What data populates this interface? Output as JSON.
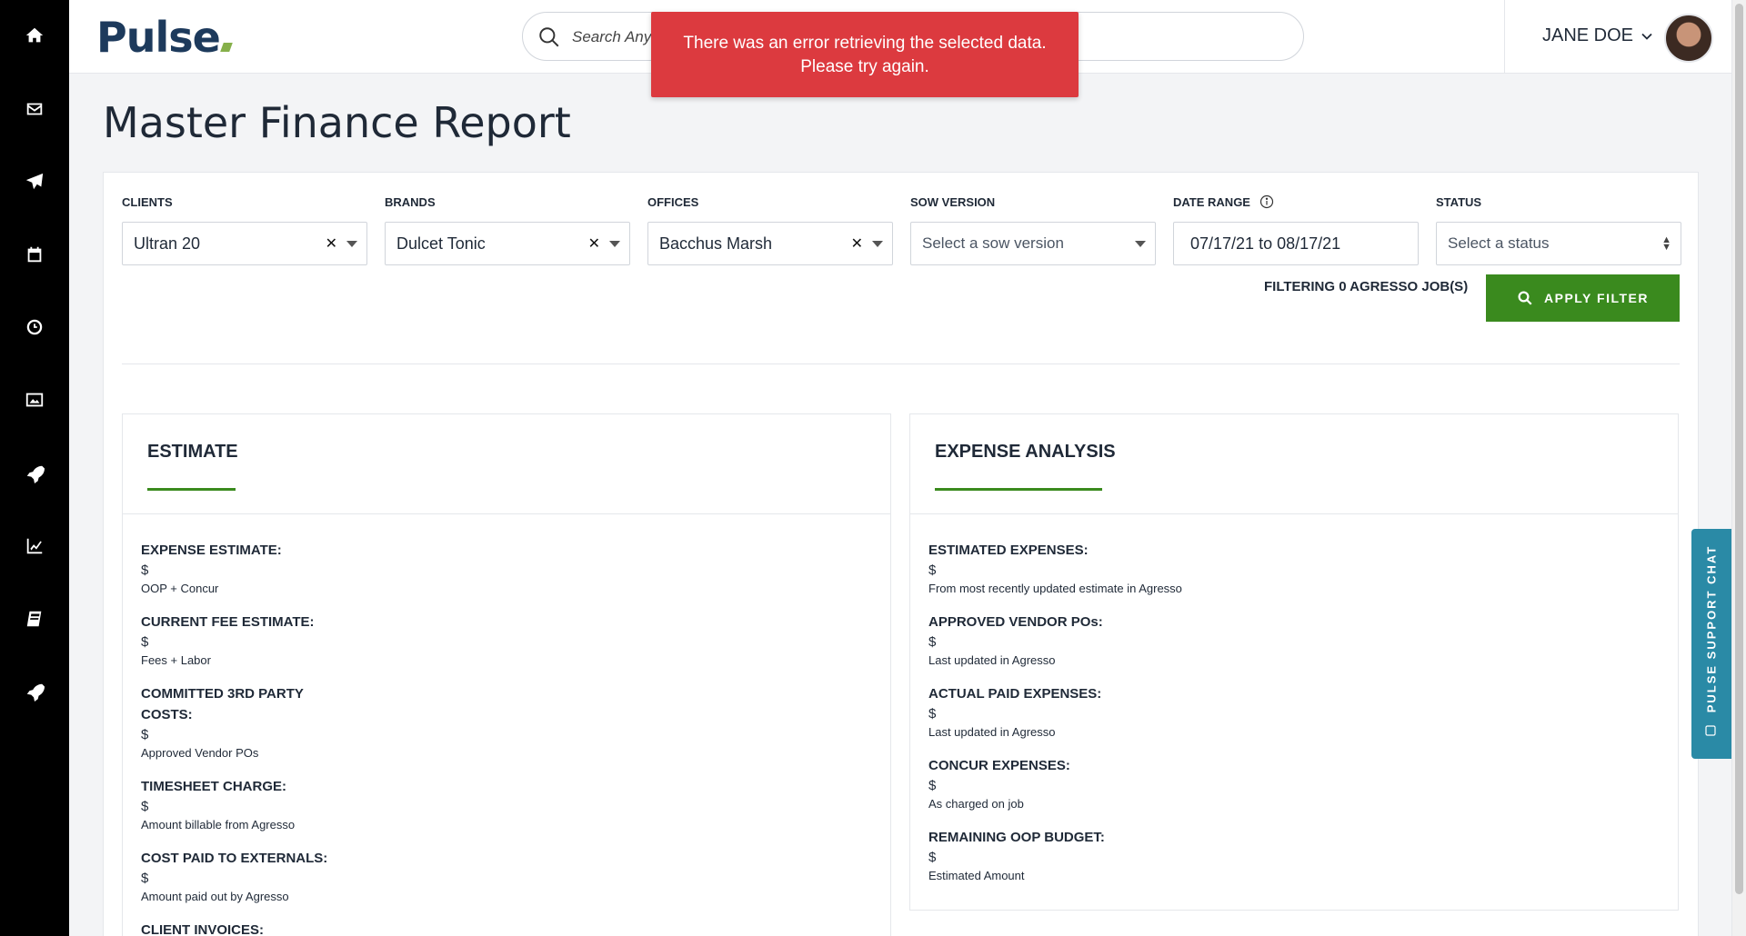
{
  "app": {
    "logo_text": "Pulse",
    "search_placeholder": "Search Anything",
    "user_name": "JANE DOE"
  },
  "sidebar": {
    "items": [
      {
        "name": "home-icon"
      },
      {
        "name": "mail-icon"
      },
      {
        "name": "send-icon"
      },
      {
        "name": "calendar-icon"
      },
      {
        "name": "clock-icon"
      },
      {
        "name": "image-icon"
      },
      {
        "name": "rocket-icon"
      },
      {
        "name": "chart-icon"
      },
      {
        "name": "book-icon"
      },
      {
        "name": "rocket-icon"
      }
    ]
  },
  "toast": {
    "line1": "There was an error retrieving the selected data.",
    "line2": "Please try again.",
    "color": "#dc3a3f"
  },
  "page": {
    "title": "Master Finance Report"
  },
  "filters": {
    "clients": {
      "label": "CLIENTS",
      "value": "Ultran 20"
    },
    "brands": {
      "label": "BRANDS",
      "value": "Dulcet Tonic"
    },
    "offices": {
      "label": "OFFICES",
      "value": "Bacchus Marsh"
    },
    "sow_version": {
      "label": "SOW VERSION",
      "placeholder": "Select a sow version"
    },
    "date_range": {
      "label": "DATE RANGE",
      "value": "07/17/21 to 08/17/21"
    },
    "status": {
      "label": "STATUS",
      "placeholder": "Select a status"
    },
    "filtering_text": "FILTERING 0 AGRESSO JOB(S)",
    "apply_label": "APPLY FILTER"
  },
  "estimate": {
    "title": "ESTIMATE",
    "metrics": [
      {
        "label": "EXPENSE ESTIMATE:",
        "value": "$",
        "note": "OOP + Concur"
      },
      {
        "label": "CURRENT FEE ESTIMATE:",
        "value": "$",
        "note": "Fees + Labor"
      },
      {
        "label_line1": "COMMITTED 3RD PARTY",
        "label_line2": "COSTS:",
        "value": "$",
        "note": "Approved Vendor POs"
      },
      {
        "label": "TIMESHEET CHARGE:",
        "value": "$",
        "note": "Amount billable from Agresso"
      },
      {
        "label": "COST PAID TO EXTERNALS:",
        "value": "$",
        "note": "Amount paid out by Agresso"
      },
      {
        "label": "CLIENT INVOICES:"
      }
    ]
  },
  "expense_analysis": {
    "title": "EXPENSE ANALYSIS",
    "metrics": [
      {
        "label": "ESTIMATED EXPENSES:",
        "value": "$",
        "note": "From most recently updated estimate in Agresso"
      },
      {
        "label": "APPROVED VENDOR POs:",
        "value": "$",
        "note": "Last updated in Agresso"
      },
      {
        "label": "ACTUAL PAID EXPENSES:",
        "value": "$",
        "note": "Last updated in Agresso"
      },
      {
        "label": "CONCUR EXPENSES:",
        "value": "$",
        "note": "As charged on job"
      },
      {
        "label": "REMAINING OOP BUDGET:",
        "value": "$",
        "note": "Estimated Amount"
      }
    ]
  },
  "support_chat": {
    "label": "PULSE SUPPORT CHAT"
  },
  "colors": {
    "accent_green": "#3a8a1e",
    "chat_teal": "#2a8aa6",
    "brand_navy": "#1d3a5c"
  }
}
